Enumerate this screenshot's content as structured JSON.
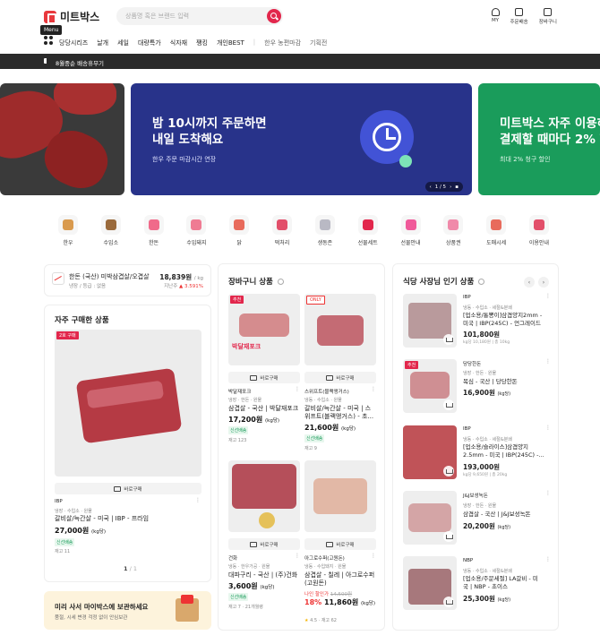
{
  "header": {
    "logo_text": "미트박스",
    "search_placeholder": "상품명 혹은 브랜드 입력",
    "icons": [
      {
        "label": "MY",
        "icon": "user-icon"
      },
      {
        "label": "주문배송",
        "icon": "truck-icon"
      },
      {
        "label": "장바구니",
        "icon": "cart-icon"
      }
    ],
    "menu_tooltip": "Menu",
    "nav": [
      "당당시리즈",
      "날개",
      "세일",
      "대량특가",
      "식자재",
      "쨍킹",
      "개인BEST"
    ],
    "nav_light": [
      "한우 농편마감",
      "기획전"
    ]
  },
  "notice": {
    "text": "8월중순 배송휴무기"
  },
  "banner": {
    "title": "밤 10시까지 주문하면\n내일 도착해요",
    "subtitle": "한우 주문 마감시간 연장",
    "pager": "1 / 5",
    "right_title": "미트박스 자주 이용하\n결제할 때마다 2% 할",
    "right_sub": "최대 2% 청구 할인",
    "colors": {
      "mid": "#28338a",
      "right": "#1a9c5b"
    }
  },
  "categories": [
    {
      "label": "한우",
      "color": "#d99a4e"
    },
    {
      "label": "수입소",
      "color": "#9a6a3c"
    },
    {
      "label": "한돈",
      "color": "#f06a8a"
    },
    {
      "label": "수입돼지",
      "color": "#ef7b93"
    },
    {
      "label": "닭",
      "color": "#e86b5c"
    },
    {
      "label": "떡처리",
      "color": "#e24f6a"
    },
    {
      "label": "생동존",
      "color": "#b9b9c4"
    },
    {
      "label": "선물세트",
      "color": "#e2274c"
    },
    {
      "label": "선물안내",
      "color": "#f05a9a"
    },
    {
      "label": "상품권",
      "color": "#f08aaa"
    },
    {
      "label": "도매시세",
      "color": "#e86b5c"
    },
    {
      "label": "이용안내",
      "color": "#e24f6a"
    }
  ],
  "price_ticker": {
    "name": "한돈 (국산) 미박삼겹살/오겹살",
    "sub": "냉장 / 등급 : 없음",
    "price": "18,839원",
    "unit": "/ kg",
    "change_label": "지난주",
    "change": "▲ 3.591%"
  },
  "recent": {
    "title": "자주 구매한 상품",
    "badge": "2호 구매",
    "buy_label": "바로구매",
    "brand": "IBP",
    "tags": "냉장 · 수입소 · 원물",
    "name": "갈비살/늑간살 - 미국 | IBP - 프라임",
    "price": "27,000원",
    "price_unit": "(kg당)",
    "fresh": "신선배송",
    "stock": "재고 11",
    "pager_current": "1",
    "pager_total": "/ 1"
  },
  "promo": {
    "title": "미리 사서 마이박스에 보관하세요",
    "sub": "품절, 시세 변경 걱정 없이 안심보관"
  },
  "cart": {
    "title": "장바구니 상품",
    "buy_label": "바로구매",
    "items": [
      {
        "badge": "추천",
        "stamp": "박달재포크",
        "brand": "박달재포크",
        "tags": "냉장 · 한돈 · 원물",
        "name": "삼겹살 - 국산 | 박달재포크",
        "price": "17,200원",
        "unit": "(kg당)",
        "fresh": "신선배송",
        "stock": "재고 123"
      },
      {
        "only": "ONLY",
        "brand": "스위프트(블랙앵거스)",
        "tags": "냉동 · 수입소 · 원물",
        "name": "갈비살/늑간살 - 미국 | 스\n위프트(블랙앵거스) - 초...",
        "price": "21,600원",
        "unit": "(kg당)",
        "fresh": "신선배송",
        "stock": "재고 9"
      },
      {
        "brand": "건화",
        "tags": "냉동 · 한우가공 · 원물",
        "name": "대파구리 - 국산 | (주)건화",
        "price": "3,600원",
        "unit": "(kg당)",
        "fresh": "신선배송",
        "stock": "재고 7 · 21개월령"
      },
      {
        "brand": "아그로수퍼(고원돈)",
        "tags": "냉동 · 수입돼지 · 원물",
        "name": "삼겹살 - 칠레 | 아그로수퍼\n(고원돈)",
        "sale": "나인 할인가",
        "old": "14,500원",
        "pct": "18%",
        "price": "11,860원",
        "unit": "(kg당)",
        "rating": "4.5",
        "stock": "재고 62"
      }
    ]
  },
  "bizpop": {
    "title": "식당 사장님 인기 상품",
    "items": [
      {
        "brand": "IBP",
        "tags": "냉동 · 수입소 · 세절&분쇄",
        "name": "[업소용/통뽕이]삼겹양지2mm -\n미국 | IBP(245C) - 언그레이드",
        "price": "101,800원",
        "meta": "kg당 10,180원 | 총 10kg"
      },
      {
        "badge": "추천",
        "brand": "당당한돈",
        "tags": "냉장 · 한돈 · 원물",
        "name": "목심 - 국산 | 당당한돈",
        "price": "16,900원",
        "unit": "(kg당)"
      },
      {
        "brand": "IBP",
        "tags": "냉동 · 수입소 · 세절&분쇄",
        "name": "[업소용/슬라이스]삼겹양지\n2.5mm - 미국 | IBP(245C) -...",
        "price": "193,000원",
        "meta": "kg당 9,650원 | 총 20kg"
      },
      {
        "brand": "J&J보성녹돈",
        "tags": "냉장 · 한돈 · 원물",
        "name": "삼겹살 - 국산 | J&J보성녹돈",
        "price": "20,200원",
        "unit": "(kg당)"
      },
      {
        "brand": "NBP",
        "tags": "냉동 · 수입소 · 세절&분쇄",
        "name": "[업소용/주문세절] LA갈비 - 미\n국 | NBP - 초이스",
        "price": "25,300원",
        "unit": "(kg당)"
      }
    ]
  }
}
